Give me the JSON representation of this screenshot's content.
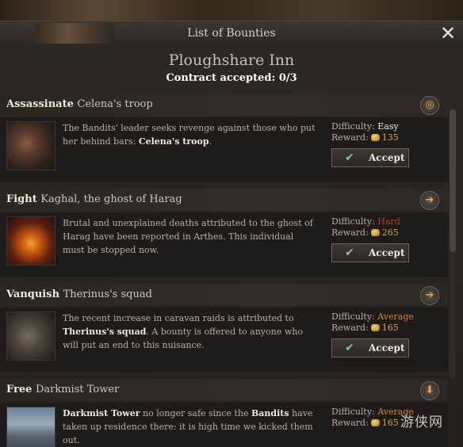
{
  "window": {
    "title": "List of Bounties",
    "close_glyph": "✕",
    "inn_name": "Ploughshare Inn",
    "contract_status": "Contract accepted: 0/3"
  },
  "labels": {
    "difficulty": "Difficulty:",
    "reward": "Reward:",
    "accept": "Accept"
  },
  "bounties": [
    {
      "verb": "Assassinate",
      "target": "Celena's troop",
      "desc_text": "The Bandits' leader seeks revenge against those who put her behind bars: ",
      "desc_bold": "Celena's troop",
      "desc_end": ".",
      "difficulty": "Easy",
      "reward": "135",
      "icon": "target-icon"
    },
    {
      "verb": "Fight",
      "target": "Kaghal, the ghost of Harag",
      "desc_text": "Brutal and unexplained deaths attributed to the ghost of Harag have been reported in Arthes. This individual must be stopped now.",
      "difficulty": "Hard",
      "reward": "265",
      "icon": "arrow-right-icon"
    },
    {
      "verb": "Vanquish",
      "target": "Therinus's squad",
      "desc_text": "The recent increase in caravan raids is attributed to ",
      "desc_bold": "Therinus's squad",
      "desc_end": ". A bounty is offered to anyone who will put an end to this nuisance.",
      "difficulty": "Average",
      "reward": "165",
      "icon": "arrow-right-icon"
    },
    {
      "verb": "Free",
      "target": "Darkmist Tower",
      "desc_bold": "Darkmist Tower",
      "desc_text": " no longer safe since the ",
      "desc_bold2": "Bandits",
      "desc_end": " have taken up residence there: it is high time we kicked them out.",
      "difficulty": "Average",
      "reward": "165",
      "icon": "arrow-down-icon"
    }
  ],
  "watermark": "游侠网",
  "colors": {
    "easy": "#efe9de",
    "hard": "#c6382a",
    "average": "#d9822f",
    "gold": "#e0a64b"
  }
}
